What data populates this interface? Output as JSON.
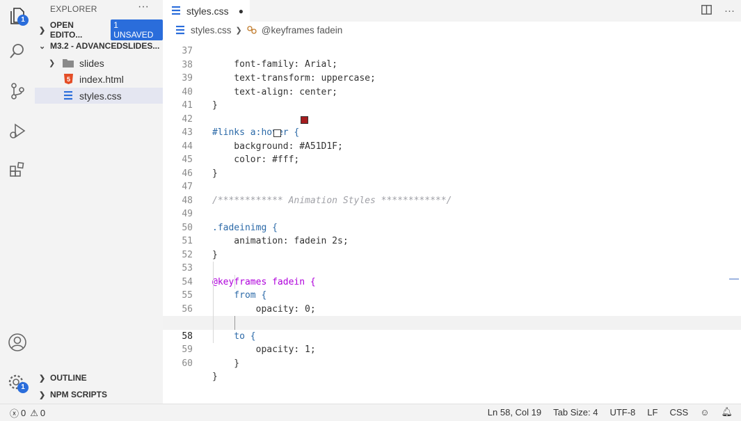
{
  "activity_bar": {
    "explorer_badge": "1",
    "settings_badge": "1"
  },
  "sidebar": {
    "title": "EXPLORER",
    "more": "···",
    "open_editors": {
      "label": "OPEN EDITO...",
      "badge": "1 UNSAVED"
    },
    "folder": {
      "label": "M3.2 - ADVANCEDSLIDES..."
    },
    "items": [
      {
        "label": "slides",
        "type": "folder"
      },
      {
        "label": "index.html",
        "type": "html"
      },
      {
        "label": "styles.css",
        "type": "css",
        "selected": true
      }
    ],
    "outline": "OUTLINE",
    "npm_scripts": "NPM SCRIPTS"
  },
  "tab": {
    "label": "styles.css",
    "dirty": "●"
  },
  "breadcrumbs": {
    "file": "styles.css",
    "symbol": "@keyframes fadein"
  },
  "editor": {
    "lines": [
      {
        "n": "37",
        "text": "    font-family: Arial;"
      },
      {
        "n": "38",
        "text": "    text-transform: uppercase;"
      },
      {
        "n": "39",
        "text": "    text-align: center;"
      },
      {
        "n": "40",
        "text": "}"
      },
      {
        "n": "41",
        "text": ""
      },
      {
        "n": "42",
        "text": "#links a:hover {"
      },
      {
        "n": "43",
        "text": "    background: #A51D1F;"
      },
      {
        "n": "44",
        "text": "    color: #fff;"
      },
      {
        "n": "45",
        "text": "}"
      },
      {
        "n": "46",
        "text": ""
      },
      {
        "n": "47",
        "text": "/************ Animation Styles ************/"
      },
      {
        "n": "48",
        "text": ""
      },
      {
        "n": "49",
        "text": ".fadeinimg {"
      },
      {
        "n": "50",
        "text": "    animation: fadein 2s;"
      },
      {
        "n": "51",
        "text": "}"
      },
      {
        "n": "52",
        "text": ""
      },
      {
        "n": "53",
        "text": "@keyframes fadein {"
      },
      {
        "n": "54",
        "text": "    from {"
      },
      {
        "n": "55",
        "text": "        opacity: 0;"
      },
      {
        "n": "56",
        "text": "    }"
      },
      {
        "n": "57",
        "text": "    to {"
      },
      {
        "n": "58",
        "text": "        opacity: 1;"
      },
      {
        "n": "59",
        "text": "    }"
      },
      {
        "n": "60",
        "text": "}"
      }
    ],
    "swatches": {
      "background": "#A51D1F",
      "color": "#ffffff"
    }
  },
  "status_bar": {
    "errors": "0",
    "warnings": "0",
    "position": "Ln 58, Col 19",
    "tab_size": "Tab Size: 4",
    "encoding": "UTF-8",
    "eol": "LF",
    "language": "CSS"
  }
}
